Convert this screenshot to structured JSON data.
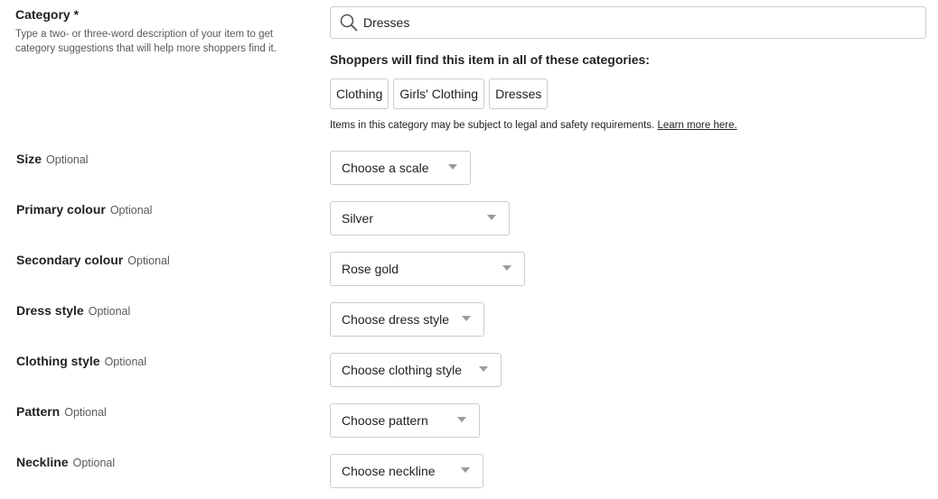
{
  "category": {
    "label": "Category",
    "required_mark": "*",
    "help_text": "Type a two- or three-word description of your item to get category suggestions that will help more shoppers find it.",
    "search_icon": "search-icon",
    "search_value": "Dresses",
    "find_heading": "Shoppers will find this item in all of these categories:",
    "chips": [
      "Clothing",
      "Girls' Clothing",
      "Dresses"
    ],
    "legal_note": "Items in this category may be subject to legal and safety requirements.",
    "learn_more": "Learn more here."
  },
  "optional_text": "Optional",
  "fields": [
    {
      "label": "Size",
      "value": "Choose a scale"
    },
    {
      "label": "Primary colour",
      "value": "Silver"
    },
    {
      "label": "Secondary colour",
      "value": "Rose gold"
    },
    {
      "label": "Dress style",
      "value": "Choose dress style"
    },
    {
      "label": "Clothing style",
      "value": "Choose clothing style"
    },
    {
      "label": "Pattern",
      "value": "Choose pattern"
    },
    {
      "label": "Neckline",
      "value": "Choose neckline"
    }
  ],
  "colors": {
    "text": "#222222",
    "muted": "#595959",
    "border": "#cccccc",
    "arrow": "#9a9a9a"
  }
}
